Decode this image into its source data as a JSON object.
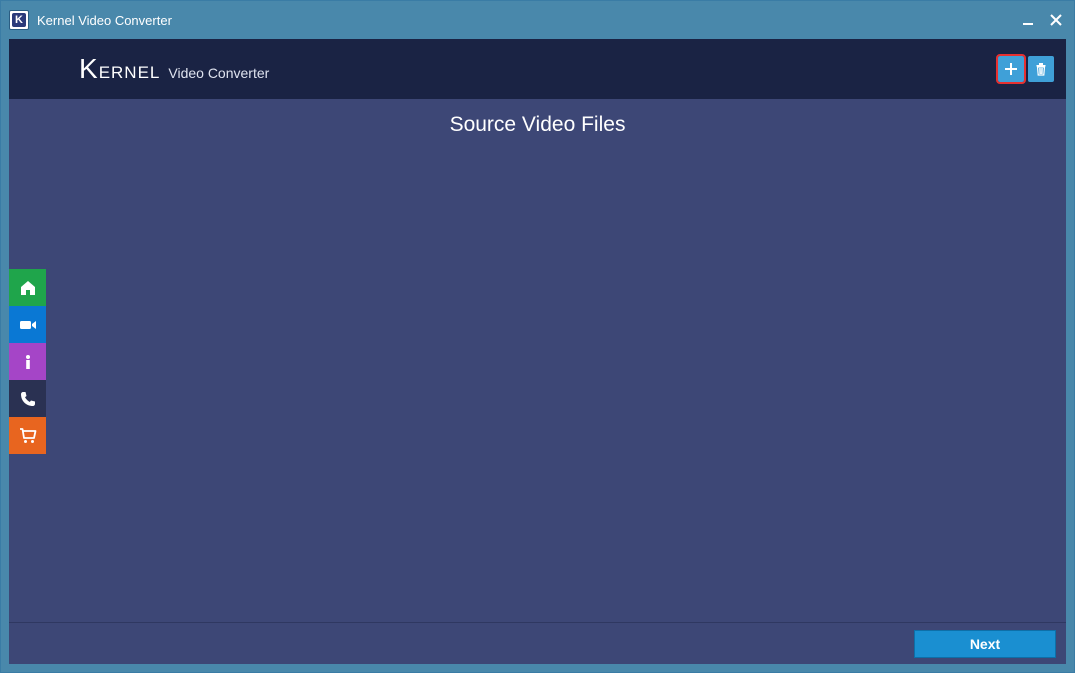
{
  "window": {
    "title": "Kernel Video Converter"
  },
  "brand": {
    "name_big": "K",
    "name_rest": "ernel",
    "subtitle": "Video Converter"
  },
  "header": {
    "icons": {
      "add": "plus-icon",
      "delete": "trash-icon"
    }
  },
  "main": {
    "panel_title": "Source Video Files"
  },
  "sidebar": {
    "items": [
      {
        "name": "home",
        "color": "#1fa54b"
      },
      {
        "name": "video",
        "color": "#0a78d4"
      },
      {
        "name": "info",
        "color": "#a545c7"
      },
      {
        "name": "contact",
        "color": "#2a3152"
      },
      {
        "name": "cart",
        "color": "#e8651f"
      }
    ]
  },
  "footer": {
    "next_label": "Next"
  }
}
